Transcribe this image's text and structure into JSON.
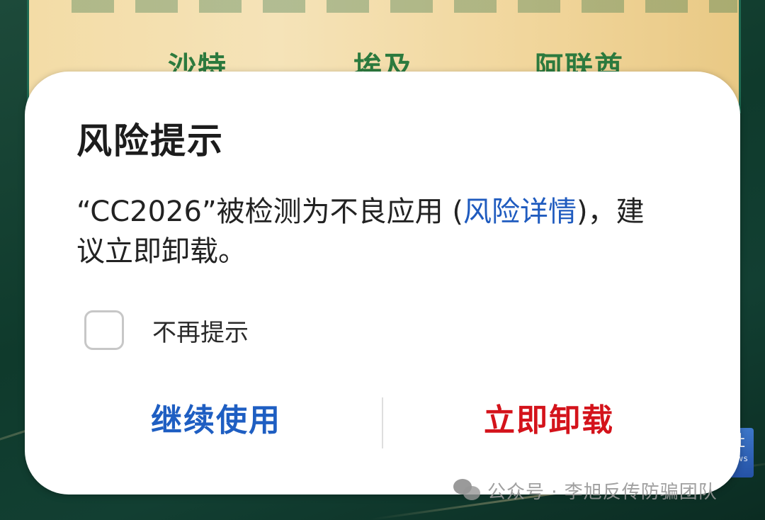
{
  "background": {
    "poster_words": [
      "沙特",
      "埃及",
      "阿联酋"
    ],
    "news_badge": {
      "char": "社",
      "label": "NEWS"
    }
  },
  "dialog": {
    "title": "风险提示",
    "message": {
      "prefix": "“CC2026”被检测为不良应用 (",
      "link": "风险详情",
      "suffix": ")，建议立即卸载。"
    },
    "checkbox": {
      "label": "不再提示",
      "checked": false
    },
    "buttons": {
      "continue_label": "继续使用",
      "uninstall_label": "立即卸载"
    }
  },
  "watermark": {
    "text": "公众号 · 李旭反传防骗团队"
  },
  "colors": {
    "link": "#1f5bbf",
    "continue_button": "#1e5ec2",
    "uninstall_button": "#d4131b"
  }
}
